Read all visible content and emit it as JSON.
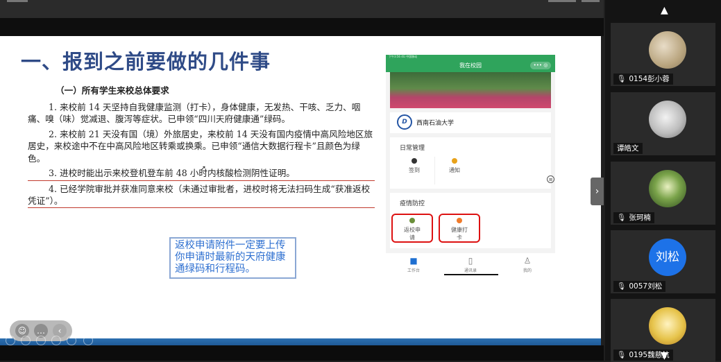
{
  "slide": {
    "title": "一、报到之前要做的几件事",
    "section_heading": "（一）所有学生来校总体要求",
    "paragraphs": [
      "1. 来校前 14 天坚持自我健康监测（打卡），身体健康，无发热、干咳、乏力、咽痛、嗅（味）觉减退、腹泻等症状。已申领“四川天府健康通”绿码。",
      "2. 来校前 21 天没有国（境）外旅居史，来校前 14 天没有国内疫情中高风险地区旅居史，来校途中不在中高风险地区转乘或换乘。已申领“通信大数据行程卡”且颜色为绿色。",
      "3. 进校时能出示来校登机登车前 48 小时内核酸检测阴性证明。",
      "4. 已经学院审批并获准同意来校（未通过审批者，进校时将无法扫码生成“获准返校凭证”）。"
    ],
    "note": "返校申请附件一定要上传你申请时最新的天府健康通绿码和行程码。"
  },
  "phone": {
    "status": "下午3:56  4G 中国移动",
    "nav_title": "我在校园",
    "capsule": "••• ◎",
    "school_logo": "D",
    "school_name": "西南石油大学",
    "daily_title": "日常管理",
    "daily_items": [
      {
        "label": "签到"
      },
      {
        "label": "通知"
      }
    ],
    "epidemic_title": "疫情防控",
    "epidemic_items": [
      {
        "label_line1": "返校申",
        "label_line2": "请"
      },
      {
        "label_line1": "健康打",
        "label_line2": "卡"
      }
    ],
    "tabs": [
      {
        "label": "工作台",
        "icon": "■"
      },
      {
        "label": "通讯录",
        "icon": "▯"
      },
      {
        "label": "我的",
        "icon": "♙"
      }
    ],
    "side_icon": "≡"
  },
  "toolbar": {
    "emoji": "☺",
    "chat": "…",
    "collapse": "‹"
  },
  "panel": {
    "toggle": "›",
    "up": "▲",
    "down": "▼",
    "mic_icon": "🎙",
    "participants": [
      {
        "name": "0154彭小蓉",
        "avatar_text": "",
        "color": "#c9b89a",
        "muted": true
      },
      {
        "name": "谭皓文",
        "avatar_text": "",
        "color": "#bdbdbd",
        "muted": false
      },
      {
        "name": "张珂楠",
        "avatar_text": "",
        "color": "#4f7a34",
        "muted": true
      },
      {
        "name": "0057刘松",
        "avatar_text": "刘松",
        "color": "#1d72e8",
        "muted": true
      },
      {
        "name": "0195魏慈航",
        "avatar_text": "",
        "color": "#e6c34a",
        "muted": true
      }
    ]
  }
}
